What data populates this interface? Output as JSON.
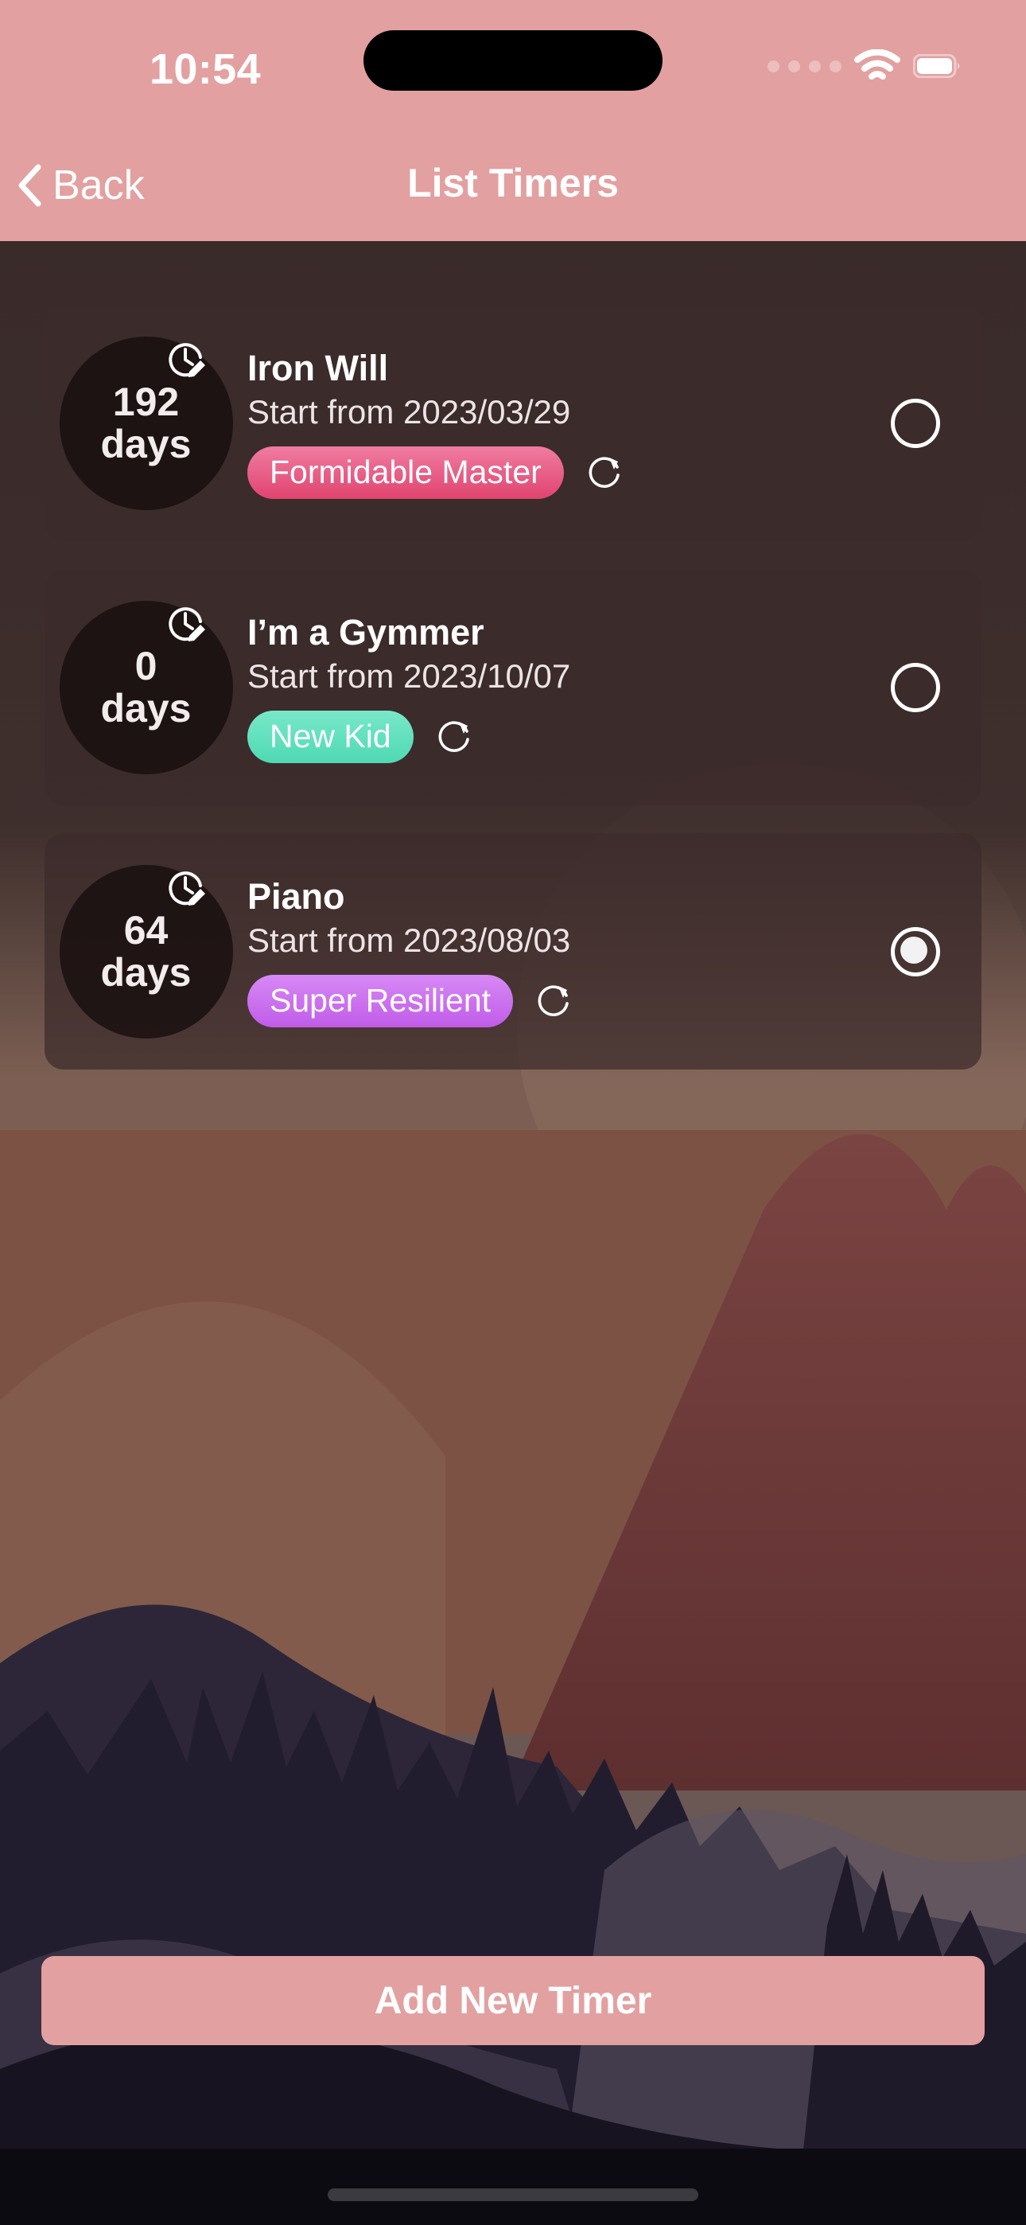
{
  "status_bar": {
    "time": "10:54",
    "signal_icon": "signal-dots-icon",
    "wifi_icon": "wifi-icon",
    "battery_icon": "battery-full-icon"
  },
  "navbar": {
    "back_label": "Back",
    "back_icon": "chevron-left-icon",
    "title": "List Timers",
    "background_color": "#e3a0a0"
  },
  "timers": [
    {
      "count": "192",
      "unit": "days",
      "title": "Iron Will",
      "start": "Start from 2023/03/29",
      "badge_label": "Formidable Master",
      "badge_color": "#e0446f",
      "badge_class": "badge-pink",
      "refresh_icon": "refresh-icon",
      "clock_icon": "clock-edit-icon",
      "selected": false
    },
    {
      "count": "0",
      "unit": "days",
      "title": "I’m a Gymmer",
      "start": "Start from 2023/10/07",
      "badge_label": "New Kid",
      "badge_color": "#4fd9b4",
      "badge_class": "badge-teal",
      "refresh_icon": "refresh-icon",
      "clock_icon": "clock-edit-icon",
      "selected": false
    },
    {
      "count": "64",
      "unit": "days",
      "title": "Piano",
      "start": "Start from 2023/08/03",
      "badge_label": "Super Resilient",
      "badge_color": "#c05ce8",
      "badge_class": "badge-purple",
      "refresh_icon": "refresh-icon",
      "clock_icon": "clock-edit-icon",
      "selected": true
    }
  ],
  "footer": {
    "add_button_label": "Add New Timer",
    "add_button_color": "#e3a0a0"
  }
}
